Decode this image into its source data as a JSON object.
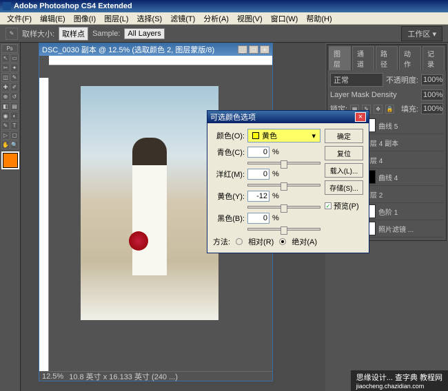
{
  "app": {
    "title": "Adobe Photoshop CS4 Extended"
  },
  "menu": {
    "file": "文件(F)",
    "edit": "编辑(E)",
    "image": "图像(I)",
    "layer": "图层(L)",
    "select": "选择(S)",
    "filter": "滤镜(T)",
    "analysis": "分析(A)",
    "view": "视图(V)",
    "window": "窗口(W)",
    "help": "帮助(H)"
  },
  "options": {
    "sample_size_label": "取样大小:",
    "sample_size_value": "取样点",
    "sample_label": "Sample:",
    "sample_value": "All Layers",
    "workarea": "工作区 ▾"
  },
  "doc": {
    "title": "DSC_0030 副本 @ 12.5% (选取颜色 2, 图层蒙版/8)",
    "zoom": "12.5%",
    "dims": "10.8 英寸 x 16.133 英寸 (240 ...)"
  },
  "dialog": {
    "title": "可选颜色选项",
    "color_label": "颜色(O):",
    "color_value": "黄色",
    "sliders": [
      {
        "label": "青色(C):",
        "value": "0"
      },
      {
        "label": "洋红(M):",
        "value": "0"
      },
      {
        "label": "黄色(Y):",
        "value": "-12"
      },
      {
        "label": "黑色(B):",
        "value": "0"
      }
    ],
    "pct": "%",
    "method_label": "方法:",
    "method_rel": "相对(R)",
    "method_abs": "绝对(A)",
    "btn_ok": "确定",
    "btn_reset": "复位",
    "btn_load": "载入(L)...",
    "btn_save": "存储(S)...",
    "preview": "预览(P)"
  },
  "panels": {
    "tabs": {
      "layers": "图层",
      "channels": "通道",
      "paths": "路径",
      "actions": "动作",
      "history": "记录"
    },
    "blend": "正常",
    "opacity_label": "不透明度:",
    "opacity": "100%",
    "mask_label": "Layer Mask Density",
    "mask": "100%",
    "lock_label": "锁定:",
    "fill_label": "填充:",
    "fill": "100%",
    "layers": [
      {
        "name": "曲线 5"
      },
      {
        "name": "图层 4 副本"
      },
      {
        "name": "图层 4"
      },
      {
        "name": "曲线 4"
      },
      {
        "name": "图层 2"
      },
      {
        "name": "色阶 1"
      },
      {
        "name": "照片滤镜 ..."
      }
    ]
  },
  "watermark": {
    "site": "查字典 教程网",
    "url": "jiaocheng.chazidian.com",
    "left": "思缘设计..."
  }
}
